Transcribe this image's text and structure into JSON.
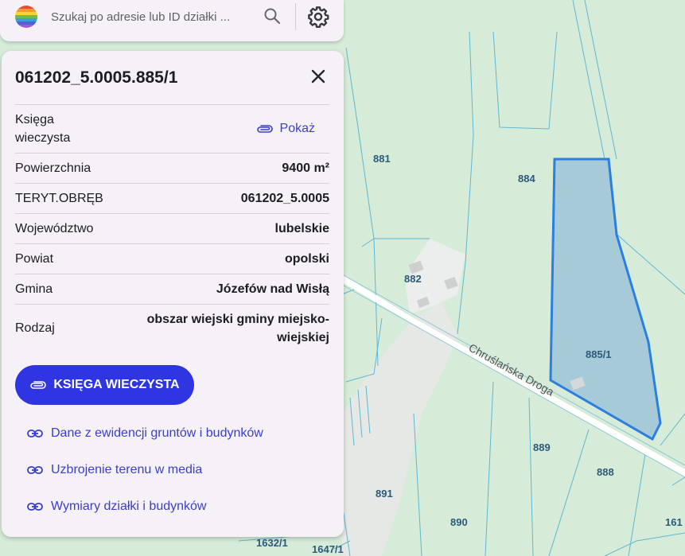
{
  "search": {
    "placeholder": "Szukaj po adresie lub ID działki ..."
  },
  "icons": {
    "search": "search-icon",
    "settings": "gear-icon",
    "close": "close-icon",
    "link": "link-icon",
    "paperclip": "paperclip-icon"
  },
  "panel": {
    "title": "061202_5.0005.885/1",
    "rows": [
      {
        "label": "Księga wieczysta",
        "value": "Pokaż"
      },
      {
        "label": "Powierzchnia",
        "value": "9400 m²"
      },
      {
        "label": "TERYT.OBRĘB",
        "value": "061202_5.0005"
      },
      {
        "label": "Województwo",
        "value": "lubelskie"
      },
      {
        "label": "Powiat",
        "value": "opolski"
      },
      {
        "label": "Gmina",
        "value": "Józefów nad Wisłą"
      },
      {
        "label": "Rodzaj",
        "value": "obszar wiejski gminy miejsko-wiejskiej"
      }
    ],
    "kw_button_label": "KSIĘGA WIECZYSTA",
    "links": [
      "Dane z ewidencji gruntów i budynków",
      "Uzbrojenie terenu w media",
      "Wymiary działki i budynków"
    ]
  },
  "map": {
    "parcels": [
      "881",
      "884",
      "882",
      "885/1",
      "889",
      "888",
      "891",
      "890",
      "161",
      "1632/1",
      "1647/1"
    ],
    "road_name": "Chruślańska Droga"
  },
  "colors": {
    "accent": "#2f35e0",
    "link": "#3b3fc8",
    "map_green": "#d6ecd9",
    "parcel_fill": "#a7cad8",
    "parcel_border": "#2a7fe0"
  }
}
